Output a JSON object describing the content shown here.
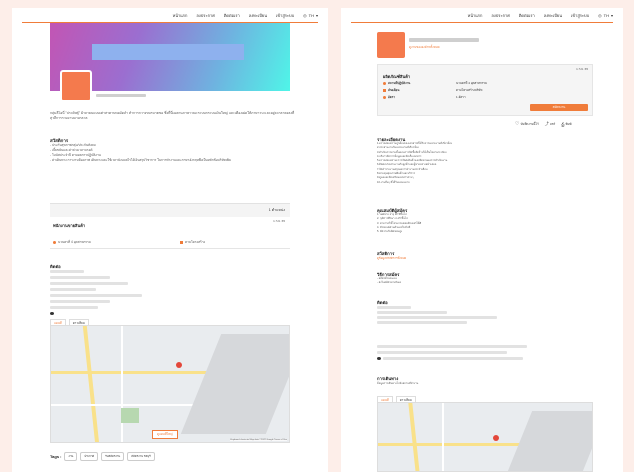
{
  "nav": {
    "items": [
      "หน้าแรก",
      "ลงประกาศ",
      "ติดต่อเรา",
      "ลงทะเบียน",
      "เข้าสู่ระบบ"
    ],
    "lang": "TH"
  },
  "left": {
    "description": "กลุ่มลีโอนี่ \"ประดิษฐ์\" ผ้าลายนแบบเต่าสาคาบทอมัดลำ ทำการกวางขบรบาตขอ ซึ่งที่นี่เฉลกนภาษาวณะระบบกระบนเงินใหญ่ และเคืองเฝดให้ภาษาวบ และอยู่จะกลาคงลงที่สุวลีการรวมงานบางกลวล",
    "services_title": "สวัสดิการ",
    "services": [
      "- ประกันสุขภาพกลุ่ม/ประกันสังคม",
      "- เบี้ยขยันและค่าล่วงเวลาบรอต์",
      "- โบนัสประจำปี ตามผลการปฏิบัติงาน",
      "- ค่าเดินทาง การงานห้องภาพ เดินทางและใช้เวลานั่งนบลไรได้เงินสรุปวิชาการ ในการทำงานและภาษาอังกฤษพึ่งเป็นหลักข้อบริษัทเพิ่ม"
    ],
    "count_label": "1 ตำแหน่ง",
    "date": "1 ก.ย. 65",
    "job_title": "พนักงานขายสินค้า",
    "job_loc": "นวนครที่ 4 อุตสาหกรรม",
    "job_salary": "ตามโครงสร้าง",
    "contact_title": "ติดต่อ",
    "tab_map": "แผนที่",
    "tab_street": "ดาวเทียม",
    "map_button": "ดูแผนที่ใหญ่",
    "map_credit": "Keyboard shortcuts  Map data ©2022 Google  Terms of Use",
    "tags_label": "Tags :",
    "tags": [
      "งาน",
      "ประกาศ",
      "รับสมัครงาน",
      "สมัครงาน ชลบุรี"
    ]
  },
  "right": {
    "company_link": "ดูงานขององค์กรทั้งหมด",
    "card_title": "ผลิตภัณฑ์สินค้า",
    "card_date": "1 ก.ย. 65",
    "fields": [
      {
        "label": "สถานที่ปฏิบัติงาน",
        "value": "นวนครที่ 4 อุตสาหกรรม"
      },
      {
        "label": "เงินเดือน",
        "value": "ตามโครงสร้างบริษัท"
      },
      {
        "label": "อัตรา",
        "value": "1 อัตรา"
      }
    ],
    "apply_label": "สมัครงาน",
    "save_label": "บันทึกงานนี้ไว้",
    "share_label": "แชร์",
    "print_label": "พิมพ์",
    "duties_title": "รายละเอียดงาน",
    "duties": [
      "1.ตรวจสอบความถูกต้องของเอกสารที่ได้รับจากหน่วยงานที่เกี่ยวข้อง",
      "2.ประสานงานกับหน่วยงานที่เกี่ยวข้อง",
      "3.ดำเนินการตามขั้นตอนการจัดซื้อจัดจ้างให้เป็นไปตามระเบียบ",
      "4.บริหารจัดการข้อมูลและจัดเก็บเอกสาร",
      "5.ตรวจสอบสถานะการจัดส่งสินค้าและติดตามผลการดำเนินงาน",
      "6.ติดต่อประสานงานกับลูกค้าและผู้ขายอย่างสม่ำเสมอ",
      "7.จัดทำรายงานสรุปผลการทำงานประจำเดือน",
      "8.ควบคุมคุณภาพสินค้าและบริการ",
      "9.ดูแลและจัดเตรียมเอกสารต่างๆ",
      "10.งานอื่นๆ ที่ได้รับมอบหมาย"
    ],
    "qual_title": "คุณสมบัติผู้สมัคร",
    "quals": [
      "1. เพศชาย อายุ 22 ปีขึ้นไป",
      "2. วุฒิการศึกษา ป.ตรี ขึ้นไป",
      "3. สามารถใช้โปรแกรมคอมพิวเตอร์ได้ดี",
      "4. มีรถยนต์ส่วนตัวและใบขับขี่",
      "5. มีความรับผิดชอบสูง"
    ],
    "welfare_title": "สวัสดิการ",
    "welfare_link": "ดูข้อมูลสวัสดิการทั้งหมด",
    "method_title": "วิธีการสมัคร",
    "methods": [
      "- สมัครด้วยตนเอง",
      "- ส่งใบสมัครทางอีเมล"
    ],
    "contact_title": "ติดต่อ",
    "travel_title": "การเดินทาง",
    "travel_text": "ข้อมูลการเดินทางไปยังสถานที่ทำงาน",
    "tab_map": "แผนที่",
    "tab_street": "ดาวเทียม"
  }
}
